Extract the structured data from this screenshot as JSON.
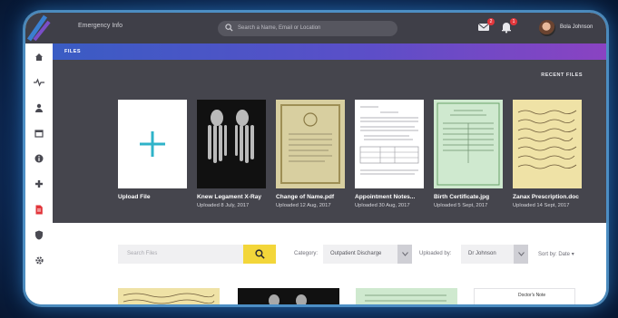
{
  "topbar": {
    "app_title": "Emergency Info",
    "search_placeholder": "Search a Name, Email or Location",
    "mail_badge": "2",
    "bell_badge": "1",
    "user_name": "Bola Johnson"
  },
  "sidebar": {
    "items": [
      "home-icon",
      "pulse-icon",
      "person-icon",
      "calendar-icon",
      "info-icon",
      "plus-icon",
      "document-icon",
      "shield-icon",
      "gear-icon"
    ],
    "active_color": "#e2363b",
    "idle_color": "#4a4a52"
  },
  "files": {
    "section_label": "FILES",
    "recent_label": "RECENT FILES",
    "cards": [
      {
        "name": "Upload File",
        "date": ""
      },
      {
        "name": "Knew Legament X-Ray",
        "date": "Uploaded 8 July, 2017"
      },
      {
        "name": "Change of Name.pdf",
        "date": "Uploaded 12 Aug, 2017"
      },
      {
        "name": "Appointment Notes...",
        "date": "Uploaded 30 Aug, 2017"
      },
      {
        "name": "Birth Certificate.jpg",
        "date": "Uploaded 5 Sept, 2017"
      },
      {
        "name": "Zanax Prescription.doc",
        "date": "Uploaded 14 Sept, 2017"
      }
    ]
  },
  "filters": {
    "search_placeholder": "Search Files",
    "category_label": "Category:",
    "category_value": "Outpatient Discharge",
    "uploaded_label": "Uploaded by:",
    "uploaded_value": "Dr Johnson",
    "sort_label": "Sort by: Date"
  },
  "bottom_thumbs": {
    "doctor_note_title": "Doctor's Note"
  },
  "colors": {
    "accent_teal": "#2fb3c9",
    "search_yellow": "#f3d63a",
    "badge_red": "#e2363b"
  }
}
